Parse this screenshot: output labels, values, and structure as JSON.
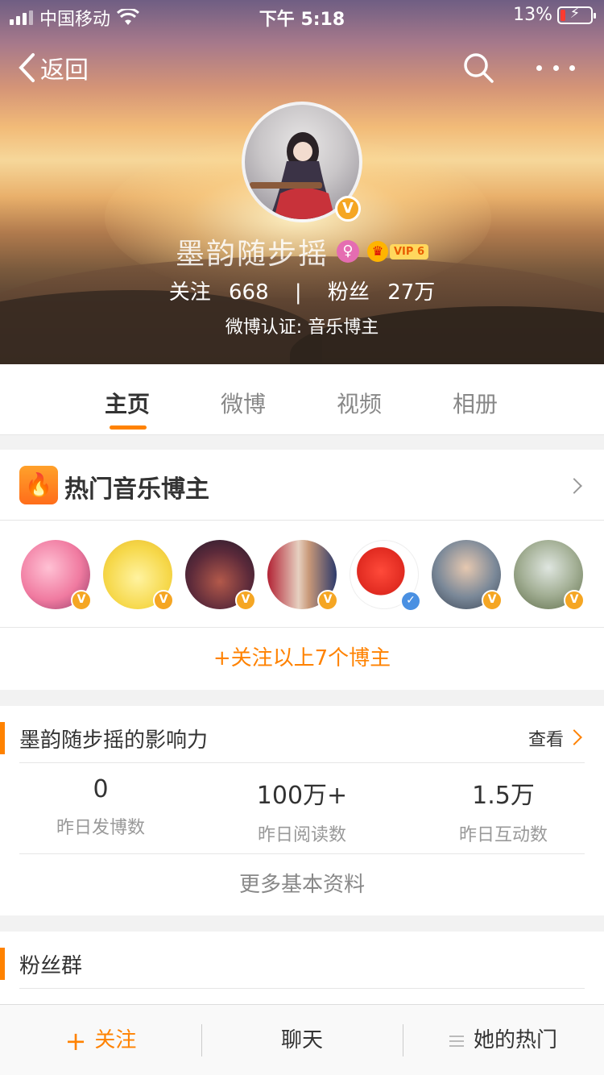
{
  "status_bar": {
    "carrier": "中国移动",
    "time": "下午 5:18",
    "battery": "13%"
  },
  "nav": {
    "back_label": "返回"
  },
  "profile": {
    "name": "墨韵随步摇",
    "vip_level": "VIP 6",
    "following_label": "关注",
    "following_count": "668",
    "fans_label": "粉丝",
    "fans_count": "27万",
    "certification": "微博认证: 音乐博主"
  },
  "tabs": [
    {
      "label": "主页",
      "active": true
    },
    {
      "label": "微博"
    },
    {
      "label": "视频"
    },
    {
      "label": "相册"
    }
  ],
  "hot_bloggers": {
    "title": "热门音乐博主",
    "follow_all": "+关注以上7个博主",
    "bloggers": [
      {
        "badge": "V",
        "badge_color": "#f5a623"
      },
      {
        "badge": "V",
        "badge_color": "#f5a623"
      },
      {
        "badge": "V",
        "badge_color": "#f5a623"
      },
      {
        "badge": "V",
        "badge_color": "#f5a623"
      },
      {
        "badge": "✓",
        "badge_color": "#4a90e2"
      },
      {
        "badge": "V",
        "badge_color": "#f5a623"
      },
      {
        "badge": "V",
        "badge_color": "#f5a623"
      }
    ]
  },
  "influence": {
    "title": "墨韵随步摇的影响力",
    "view_label": "查看",
    "metrics": [
      {
        "value": "0",
        "label": "昨日发博数"
      },
      {
        "value": "100万+",
        "label": "昨日阅读数"
      },
      {
        "value": "1.5万",
        "label": "昨日互动数"
      }
    ],
    "more_info": "更多基本资料"
  },
  "fans_group": {
    "title": "粉丝群"
  },
  "bottom_bar": {
    "follow": "关注",
    "chat": "聊天",
    "her_hot": "她的热门"
  },
  "colors": {
    "accent": "#ff8200",
    "verified_gold": "#f5a623",
    "verified_blue": "#4a90e2"
  }
}
